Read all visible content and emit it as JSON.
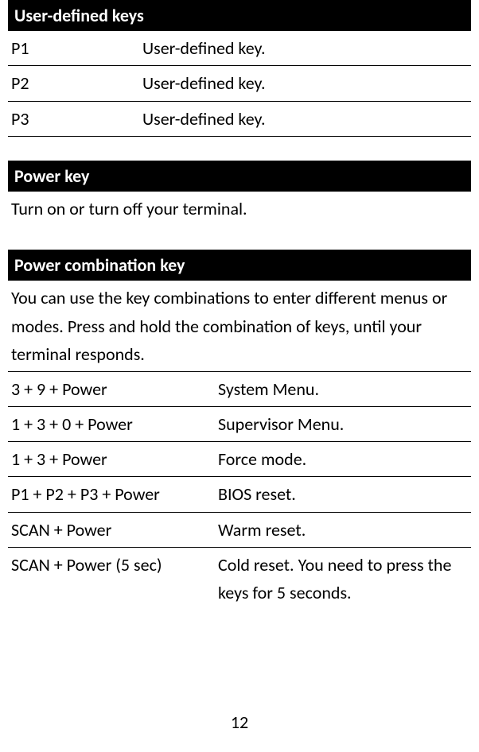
{
  "sections": {
    "userDefinedKeys": {
      "header": "User-defined keys",
      "rows": [
        {
          "key": "P1",
          "desc": "User-defined key."
        },
        {
          "key": "P2",
          "desc": "User-defined key."
        },
        {
          "key": "P3",
          "desc": "User-defined key."
        }
      ]
    },
    "powerKey": {
      "header": "Power key",
      "text": "Turn on or turn off your terminal."
    },
    "powerCombination": {
      "header": "Power combination key",
      "intro": "You can use the key combinations to enter different menus or modes. Press and hold the combination of keys, until your terminal responds.",
      "rows": [
        {
          "combo": "3 + 9 + Power",
          "desc": "System Menu."
        },
        {
          "combo": "1 + 3 + 0 + Power",
          "desc": "Supervisor Menu."
        },
        {
          "combo": "1 + 3 + Power",
          "desc": "Force mode."
        },
        {
          "combo": "P1 + P2 + P3 + Power",
          "desc": "BIOS reset."
        },
        {
          "combo": "SCAN + Power",
          "desc": "Warm reset."
        },
        {
          "combo": "SCAN + Power (5 sec)",
          "desc": "Cold reset. You need to press the keys for 5 seconds."
        }
      ]
    }
  },
  "pageNumber": "12"
}
